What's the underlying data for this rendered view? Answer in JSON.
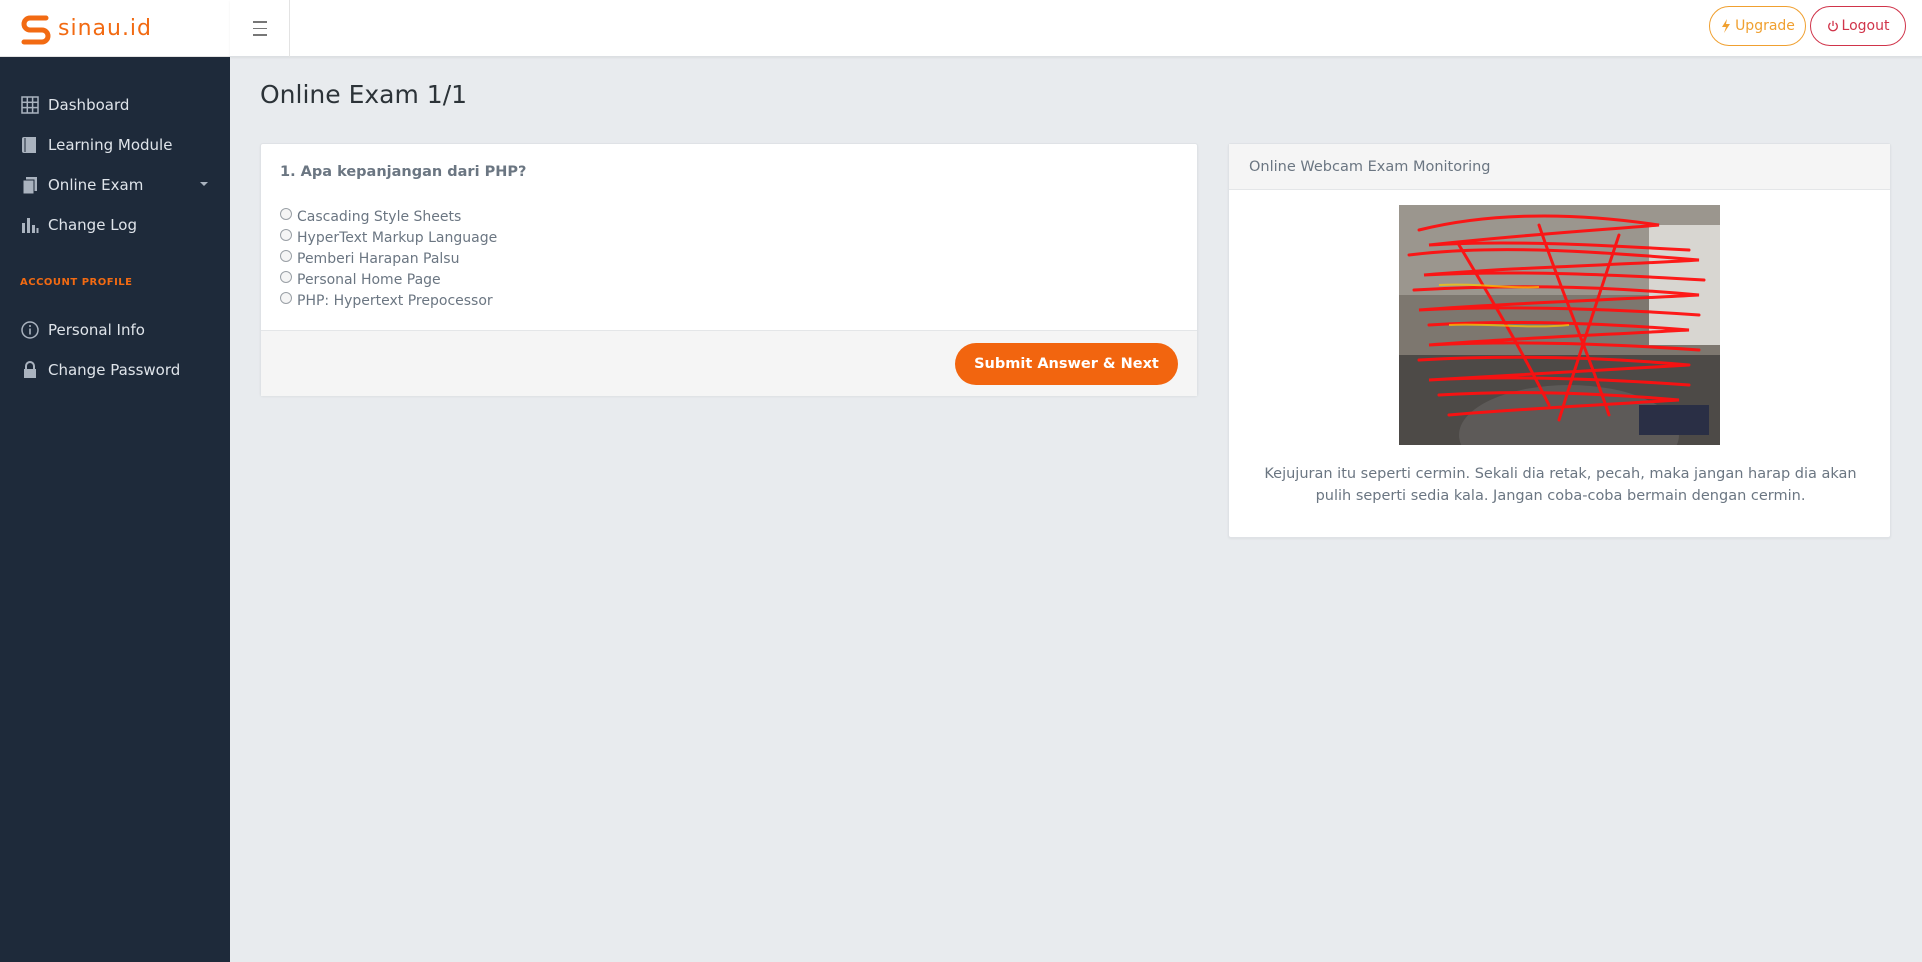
{
  "brand": {
    "name": "sinau.id",
    "accent": "#f26a12"
  },
  "sidebar": {
    "items": [
      {
        "label": "Dashboard",
        "icon": "grid-icon"
      },
      {
        "label": "Learning Module",
        "icon": "book-icon"
      },
      {
        "label": "Online Exam",
        "icon": "document-icon"
      },
      {
        "label": "Change Log",
        "icon": "bar-chart-icon"
      }
    ],
    "section_label": "ACCOUNT PROFILE",
    "profile_items": [
      {
        "label": "Personal Info",
        "icon": "info-icon"
      },
      {
        "label": "Change Password",
        "icon": "lock-icon"
      }
    ]
  },
  "header": {
    "upgrade_label": "Upgrade",
    "logout_label": "Logout"
  },
  "main": {
    "title": "Online Exam 1/1",
    "question": "1. Apa kepanjangan dari PHP?",
    "options": [
      "Cascading Style Sheets",
      "HyperText Markup Language",
      "Pemberi Harapan Palsu",
      "Personal Home Page",
      "PHP: Hypertext Prepocessor"
    ],
    "submit_label": "Submit Answer & Next"
  },
  "webcam": {
    "title": "Online Webcam Exam Monitoring",
    "quote": "Kejujuran itu seperti cermin. Sekali dia retak, pecah, maka jangan harap dia akan pulih seperti sedia kala. Jangan coba-coba bermain dengan cermin."
  }
}
